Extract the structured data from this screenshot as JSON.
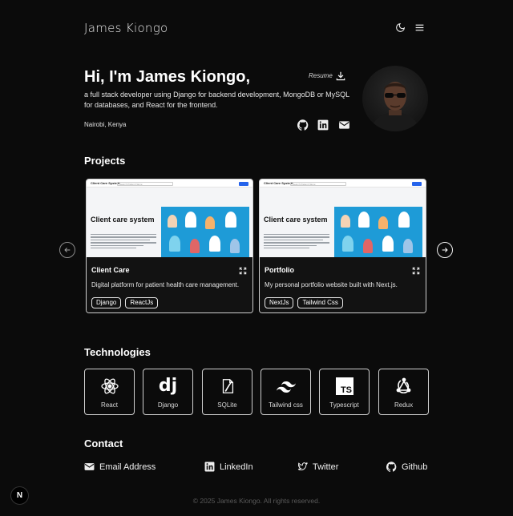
{
  "header": {
    "brand": "James Kiongo",
    "theme_icon": "moon-icon",
    "menu_icon": "hamburger-menu-icon"
  },
  "hero": {
    "title": "Hi, I'm James Kiongo,",
    "description": "a full stack developer using Django for backend development, MongoDB or MySQL for databases, and React for the frontend.",
    "location": "Nairobi, Kenya",
    "resume_label": "Resume",
    "resume_icon": "download-icon",
    "socials": [
      "github-icon",
      "linkedin-icon",
      "mail-icon"
    ]
  },
  "projects": {
    "title": "Projects",
    "items": [
      {
        "name": "Client Care",
        "description": "Digital platform for patient health care management.",
        "tags": [
          "Django",
          "ReactJs"
        ],
        "shot_brand": "Client Care System",
        "shot_search": "Search Patient Name",
        "shot_heading": "Client care system"
      },
      {
        "name": "Portfolio",
        "description": "My personal portfolio website built with Next.js.",
        "tags": [
          "NextJs",
          "Tailwind Css"
        ],
        "shot_brand": "Client Care System",
        "shot_search": "Search Patient Name",
        "shot_heading": "Client care system"
      }
    ]
  },
  "technologies": {
    "title": "Technologies",
    "items": [
      {
        "label": "React",
        "icon": "react-icon"
      },
      {
        "label": "Django",
        "icon": "django-icon"
      },
      {
        "label": "SQLite",
        "icon": "sqlite-icon"
      },
      {
        "label": "Tailwind css",
        "icon": "tailwind-icon"
      },
      {
        "label": "Typescript",
        "icon": "typescript-icon"
      },
      {
        "label": "Redux",
        "icon": "redux-icon"
      }
    ]
  },
  "contact": {
    "title": "Contact",
    "items": [
      {
        "label": "Email Address",
        "icon": "mail-icon"
      },
      {
        "label": "LinkedIn",
        "icon": "linkedin-icon"
      },
      {
        "label": "Twitter",
        "icon": "twitter-icon"
      },
      {
        "label": "Github",
        "icon": "github-icon"
      }
    ]
  },
  "footer": {
    "text": "© 2025 James Kiongo. All rights reserved."
  },
  "next_badge": "N",
  "colors": {
    "background": "#0b0b0b",
    "text": "#f2f2f2",
    "border": "#cfcfcf",
    "accent_blue": "#1e9bd7"
  }
}
